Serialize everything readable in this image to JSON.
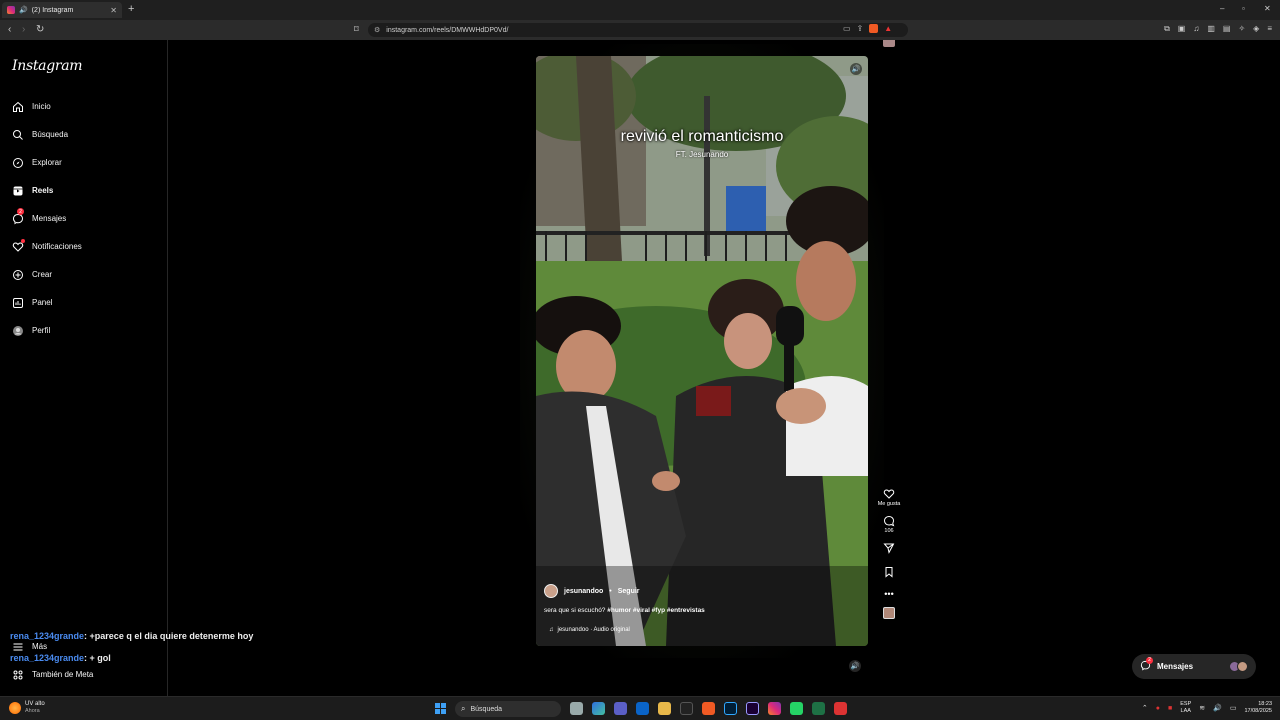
{
  "browser": {
    "tab_title": "(2) Instagram",
    "new_tab": "+",
    "url": "instagram.com/reels/DMWWHdDP0Vd/",
    "win_min": "–",
    "win_max": "▫",
    "win_close": "✕"
  },
  "sidebar": {
    "logo": "Instagram",
    "items": [
      {
        "label": "Inicio",
        "icon": "home-icon"
      },
      {
        "label": "Búsqueda",
        "icon": "search-icon"
      },
      {
        "label": "Explorar",
        "icon": "compass-icon"
      },
      {
        "label": "Reels",
        "icon": "reels-icon"
      },
      {
        "label": "Mensajes",
        "icon": "messenger-icon",
        "badge": "2"
      },
      {
        "label": "Notificaciones",
        "icon": "heart-icon"
      },
      {
        "label": "Crear",
        "icon": "plus-square-icon"
      },
      {
        "label": "Panel",
        "icon": "chart-icon"
      },
      {
        "label": "Perfil",
        "icon": "avatar-icon"
      }
    ],
    "more": "Más",
    "meta": "También de Meta"
  },
  "chat": [
    {
      "user": "rena_1234grande",
      "message": ": +parece q el dia quiere detenerme hoy"
    },
    {
      "user": "rena_1234grande",
      "message": ": + gol"
    }
  ],
  "reel": {
    "caption": "revivió el romanticismo",
    "sub_caption": "FT. Jesunando",
    "author": "jesunandoo",
    "separator": "•",
    "follow": "Seguir",
    "description_prefix": "sera que si escuchó?",
    "hashtags": "#humor #viral #fyp #entrevistas",
    "audio": "jesunandoo · Audio original",
    "likes_label": "Me gusta",
    "comments_count": "106"
  },
  "messages_pill": {
    "label": "Mensajes",
    "badge": "2"
  },
  "taskbar": {
    "weather_title": "UV alto",
    "weather_sub": "Ahora",
    "search": "Búsqueda",
    "lang_top": "ESP",
    "lang_bottom": "LAA",
    "time": "18:23",
    "date": "17/08/2025"
  },
  "colors": {
    "accent_badge": "#ff3040",
    "chat_user": "#4a8bf0",
    "brave": "#f05a24"
  }
}
